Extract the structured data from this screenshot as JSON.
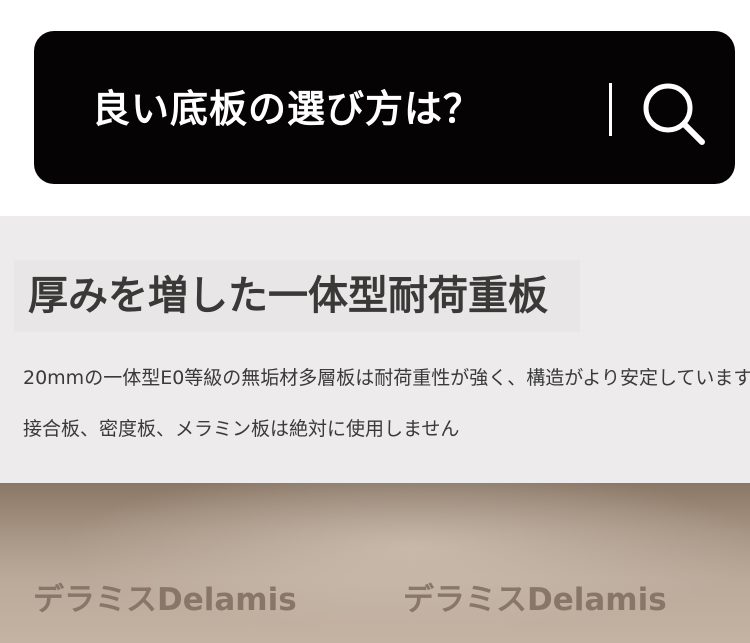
{
  "search": {
    "query": "良い底板の選び方は？",
    "icon": "search-icon"
  },
  "feature": {
    "title": "厚みを増した一体型耐荷重板",
    "description_line1": "20mmの一体型E0等級の無垢材多層板は耐荷重性が強く、構造がより安定しています",
    "description_line2": "接合板、密度板、メラミン板は絶対に使用しません"
  },
  "products": {
    "items": [
      {
        "brand": "デラミスDelamis"
      },
      {
        "brand": "デラミスDelamis"
      }
    ]
  },
  "colors": {
    "search_bar_bg": "#050303",
    "feature_bg": "#edebeb",
    "title_text": "#3a3938",
    "product_bg": "#a69483"
  }
}
